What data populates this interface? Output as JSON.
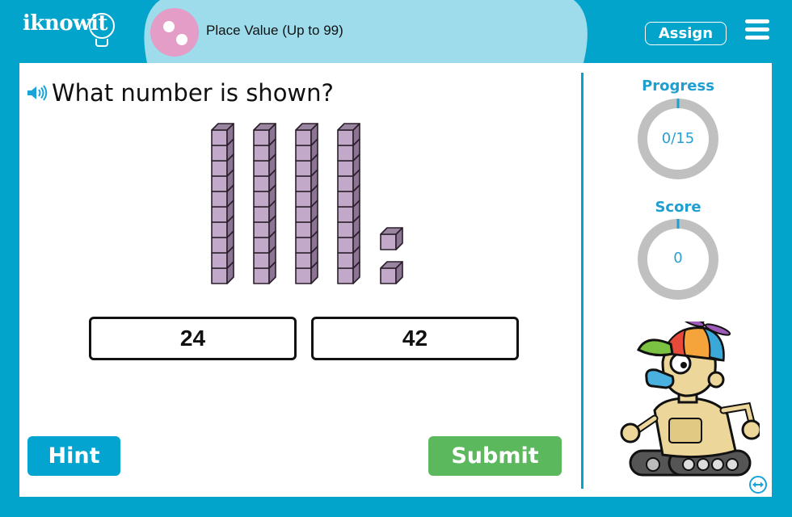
{
  "header": {
    "logo_text": "iknowit",
    "activity_title": "Place Value (Up to 99)",
    "assign_label": "Assign",
    "menu_icon": "hamburger-menu-icon",
    "activity_icon": "two-dots-icon"
  },
  "question": {
    "speaker_icon": "speaker-icon",
    "text": "What number is shown?",
    "base_ten_blocks": {
      "tens_rods": 4,
      "ones_cubes": 2,
      "color": "#c2a8c9"
    }
  },
  "answers": [
    {
      "label": "24"
    },
    {
      "label": "42"
    }
  ],
  "buttons": {
    "hint_label": "Hint",
    "submit_label": "Submit"
  },
  "sidebar": {
    "progress": {
      "label": "Progress",
      "value_text": "0/15",
      "current": 0,
      "total": 15
    },
    "score": {
      "label": "Score",
      "value_text": "0",
      "value": 0
    },
    "mascot": "robot-mascot",
    "expand_icon": "expand-arrows-icon"
  },
  "colors": {
    "brand": "#02a4cc",
    "title_bar": "#9edcec",
    "hint": "#03a5d0",
    "submit": "#5cb85c",
    "ring": "#c0c0c0"
  }
}
